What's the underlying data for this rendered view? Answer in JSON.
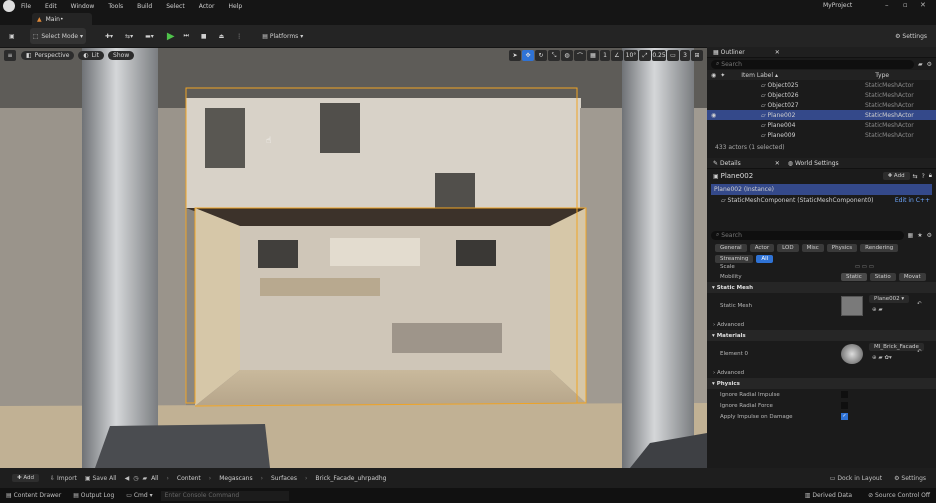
{
  "menubar": {
    "items": [
      "File",
      "Edit",
      "Window",
      "Tools",
      "Build",
      "Select",
      "Actor",
      "Help"
    ],
    "project": "MyProject"
  },
  "tab": {
    "label": "Main•"
  },
  "toolbar": {
    "mode": "Select Mode",
    "platforms": "Platforms",
    "settings": "Settings"
  },
  "viewport": {
    "perspective": "Perspective",
    "lit": "Lit",
    "show": "Show",
    "angle": "10°",
    "scale": "0.25",
    "camera": "3",
    "grid": "1"
  },
  "outliner": {
    "title": "Outliner",
    "search_placeholder": "Search",
    "col_label": "Item Label ▴",
    "col_type": "Type",
    "rows": [
      {
        "label": "Object025",
        "type": "StaticMeshActor"
      },
      {
        "label": "Object026",
        "type": "StaticMeshActor"
      },
      {
        "label": "Object027",
        "type": "StaticMeshActor"
      },
      {
        "label": "Plane002",
        "type": "StaticMeshActor"
      },
      {
        "label": "Plane004",
        "type": "StaticMeshActor"
      },
      {
        "label": "Plane009",
        "type": "StaticMeshActor"
      }
    ],
    "count": "433 actors (1 selected)"
  },
  "details": {
    "tab": "Details",
    "world_tab": "World Settings",
    "object": "Plane002",
    "add": "Add",
    "instance": "Plane002 (Instance)",
    "component": "StaticMeshComponent (StaticMeshComponent0)",
    "edit_cpp": "Edit in C++",
    "search_placeholder": "Search",
    "filters": [
      "General",
      "Actor",
      "LOD",
      "Misc",
      "Physics",
      "Rendering",
      "Streaming",
      "All"
    ],
    "scale_label": "Scale",
    "mobility_label": "Mobility",
    "mobility": [
      "Static",
      "Statio",
      "Movat"
    ],
    "sections": {
      "static_mesh": "Static Mesh",
      "materials": "Materials",
      "physics": "Physics"
    },
    "static_mesh_label": "Static Mesh",
    "static_mesh_value": "Plane002",
    "advanced": "Advanced",
    "element0": "Element 0",
    "material_value": "MI_Brick_Facade",
    "physics_props": [
      "Ignore Radial Impulse",
      "Ignore Radial Force",
      "Apply Impulse on Damage"
    ]
  },
  "bottombar": {
    "add": "Add",
    "import": "Import",
    "save_all": "Save All",
    "breadcrumbs": [
      "All",
      "Content",
      "Megascans",
      "Surfaces",
      "Brick_Facade_uhrpadhg"
    ],
    "dock": "Dock in Layout",
    "settings": "Settings"
  },
  "statusbar": {
    "drawer": "Content Drawer",
    "output": "Output Log",
    "cmd": "Cmd",
    "console_placeholder": "Enter Console Command",
    "derived": "Derived Data",
    "source": "Source Control Off"
  }
}
